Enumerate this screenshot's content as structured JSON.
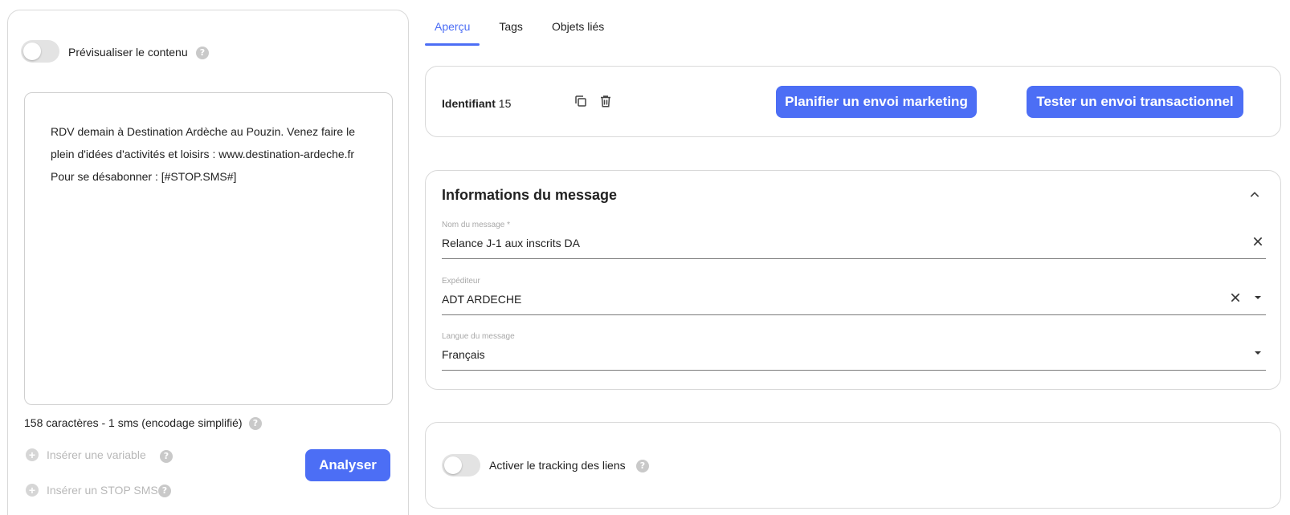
{
  "left": {
    "preview_label": "Prévisualiser le contenu",
    "sms_content": "RDV demain à Destination Ardèche au Pouzin. Venez faire le\nplein d'idées d'activités et loisirs : www.destination-ardeche.fr\nPour se désabonner : [#STOP.SMS#]",
    "char_count": "158 caractères - 1 sms (encodage simplifié)",
    "insert_variable": "Insérer une variable",
    "insert_stop": "Insérer un STOP SMS",
    "analyze_button": "Analyser"
  },
  "tabs": [
    {
      "label": "Aperçu",
      "active": true
    },
    {
      "label": "Tags",
      "active": false
    },
    {
      "label": "Objets liés",
      "active": false
    }
  ],
  "identifier": {
    "label": "Identifiant",
    "value": "15"
  },
  "actions": {
    "plan_marketing": "Planifier un envoi marketing",
    "test_transactional": "Tester un envoi transactionnel"
  },
  "message_info": {
    "title": "Informations du message",
    "name_label": "Nom du message *",
    "name_value": "Relance J-1 aux inscrits DA",
    "sender_label": "Expéditeur",
    "sender_value": "ADT ARDECHE",
    "language_label": "Langue du message",
    "language_value": "Français"
  },
  "tracking": {
    "label": "Activer le tracking des liens"
  },
  "colors": {
    "accent": "#4c6ef5",
    "border": "#d9d9d9"
  }
}
